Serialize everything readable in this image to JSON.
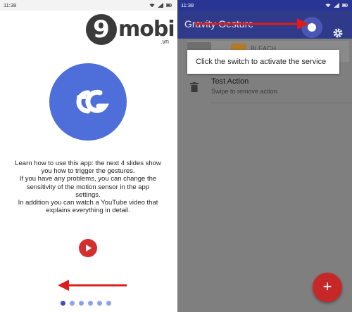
{
  "left_screen": {
    "status_time": "11:38",
    "logo": {
      "digit": "9",
      "word": "mobi",
      "domain": ".vn"
    },
    "app_icon": "gravity-gesture-logo",
    "intro_lines": [
      "Learn how to use this app: the next 4 slides show",
      "you how to trigger the gestures.",
      "If you have any problems, you can change the",
      "sensitivity of the motion sensor in the app",
      "settings.",
      "In addition you can watch a YouTube video that",
      "explains everything in detail."
    ],
    "page_count": 6,
    "active_page": 1
  },
  "right_screen": {
    "status_time": "11:38",
    "toolbar_title": "Gravity Gesture",
    "tooltip": "Click the switch to activate the service",
    "background_label": "BLEACH",
    "list_item": {
      "title": "Test Action",
      "subtitle": "Swipe to remove action"
    },
    "fab_label": "+"
  },
  "colors": {
    "primary": "#3f51b5",
    "toolbar": "#2f3b8a",
    "accent_red": "#d32f2f",
    "scrim": "#7f7f7f",
    "app_icon": "#4e6fd9"
  }
}
